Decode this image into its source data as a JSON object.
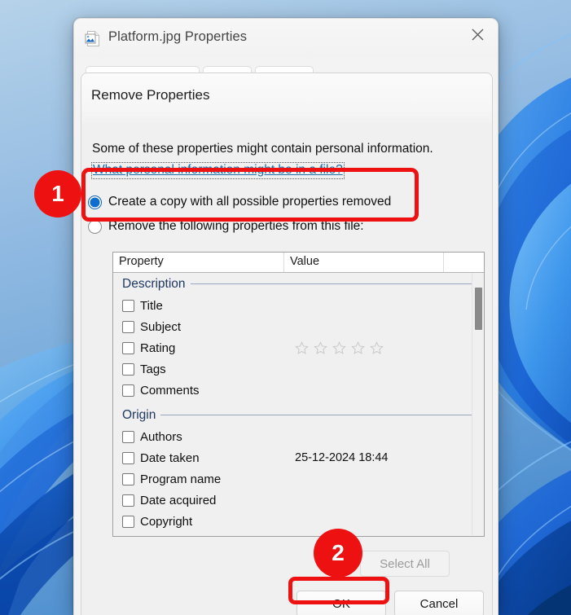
{
  "window": {
    "title": "Platform.jpg Properties",
    "file_icon": "image-file-icon",
    "close_icon": "close-icon"
  },
  "dialog": {
    "heading": "Remove Properties",
    "info_text": "Some of these properties might contain personal information.",
    "privacy_link": "What personal information might be in a file?",
    "radio_options": [
      {
        "label": "Create a copy with all possible properties removed",
        "selected": true
      },
      {
        "label": "Remove the following properties from this file:",
        "selected": false
      }
    ],
    "list": {
      "columns": [
        "Property",
        "Value",
        ""
      ],
      "groups": [
        {
          "title": "Description",
          "rows": [
            {
              "name": "Title",
              "value": "",
              "checked": false,
              "type": "text"
            },
            {
              "name": "Subject",
              "value": "",
              "checked": false,
              "type": "text"
            },
            {
              "name": "Rating",
              "value": "",
              "checked": false,
              "type": "stars",
              "stars_total": 5,
              "stars_filled": 0
            },
            {
              "name": "Tags",
              "value": "",
              "checked": false,
              "type": "text"
            },
            {
              "name": "Comments",
              "value": "",
              "checked": false,
              "type": "text"
            }
          ]
        },
        {
          "title": "Origin",
          "rows": [
            {
              "name": "Authors",
              "value": "",
              "checked": false,
              "type": "text"
            },
            {
              "name": "Date taken",
              "value": "25-12-2024 18:44",
              "checked": false,
              "type": "text"
            },
            {
              "name": "Program name",
              "value": "",
              "checked": false,
              "type": "text"
            },
            {
              "name": "Date acquired",
              "value": "",
              "checked": false,
              "type": "text"
            },
            {
              "name": "Copyright",
              "value": "",
              "checked": false,
              "type": "text"
            }
          ]
        }
      ]
    },
    "buttons": {
      "select_all": "Select All",
      "select_all_disabled": true,
      "ok": "OK",
      "cancel": "Cancel"
    }
  },
  "annotations": {
    "badge_1": "1",
    "badge_2": "2",
    "highlight_color": "#ee1111"
  }
}
